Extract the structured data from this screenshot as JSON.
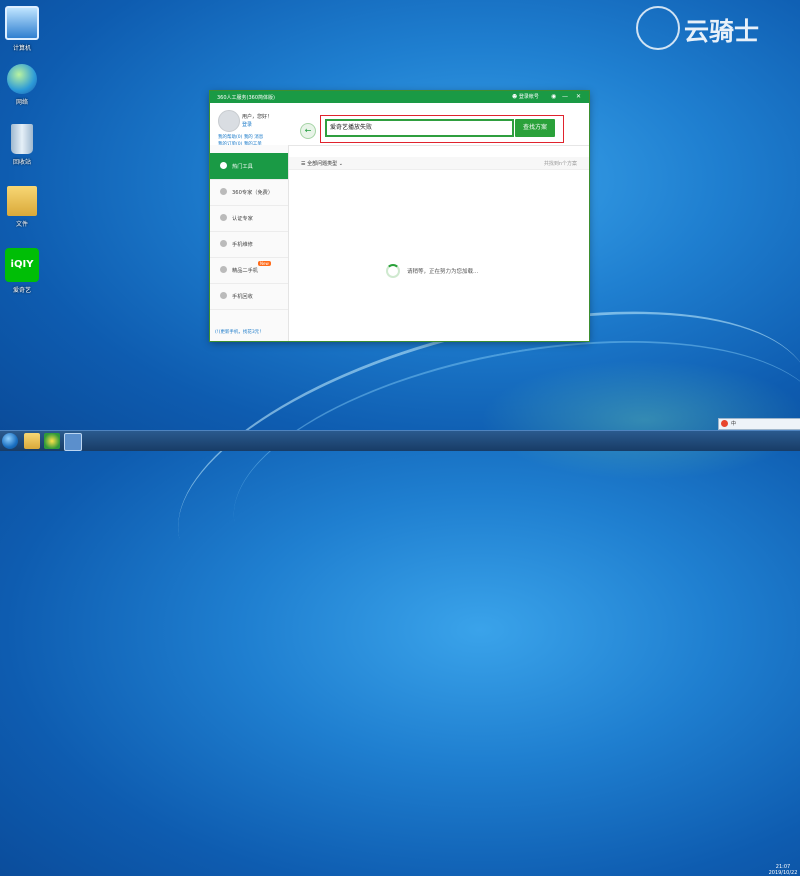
{
  "desktop": {
    "icons": [
      {
        "label": "计算机",
        "icon": "computer-icon"
      },
      {
        "label": "网络",
        "icon": "network-icon"
      },
      {
        "label": "回收站",
        "icon": "recycle-bin-icon"
      },
      {
        "label": "文件",
        "icon": "folder-icon"
      },
      {
        "label": "爱奇艺",
        "icon": "iqiyi-icon"
      }
    ],
    "watermark": "云骑士"
  },
  "window": {
    "title": "360人工服务(360简体版)",
    "login_label": "登录帐号",
    "user": {
      "name": "用户，您好！",
      "login_link": "登录",
      "links": [
        "我的帮助(0)",
        "我的",
        "消息",
        "我的订单(0)",
        "我的工单"
      ]
    },
    "search": {
      "value": "爱奇艺播放失败",
      "button": "查找方案"
    },
    "sidebar": {
      "items": [
        {
          "label": "热门工具",
          "icon": "home-icon",
          "active": true
        },
        {
          "label": "360专家（免费）",
          "icon": "expert-icon"
        },
        {
          "label": "认证专家",
          "icon": "certified-expert-icon"
        },
        {
          "label": "手机维修",
          "icon": "phone-repair-icon"
        },
        {
          "label": "精品二手机",
          "icon": "used-phone-icon",
          "badge": "New"
        },
        {
          "label": "手机回收",
          "icon": "phone-recycle-icon"
        }
      ],
      "footer": "(!)更新手机，找花3元！"
    },
    "filter": {
      "label": "全部问题类型",
      "right_text": "共找到n个方案"
    },
    "loading_text": "请稍等，正在努力为您加载..."
  },
  "taskbar": {
    "time": "21:07",
    "date": "2019/10/22",
    "tray_label": "中"
  }
}
